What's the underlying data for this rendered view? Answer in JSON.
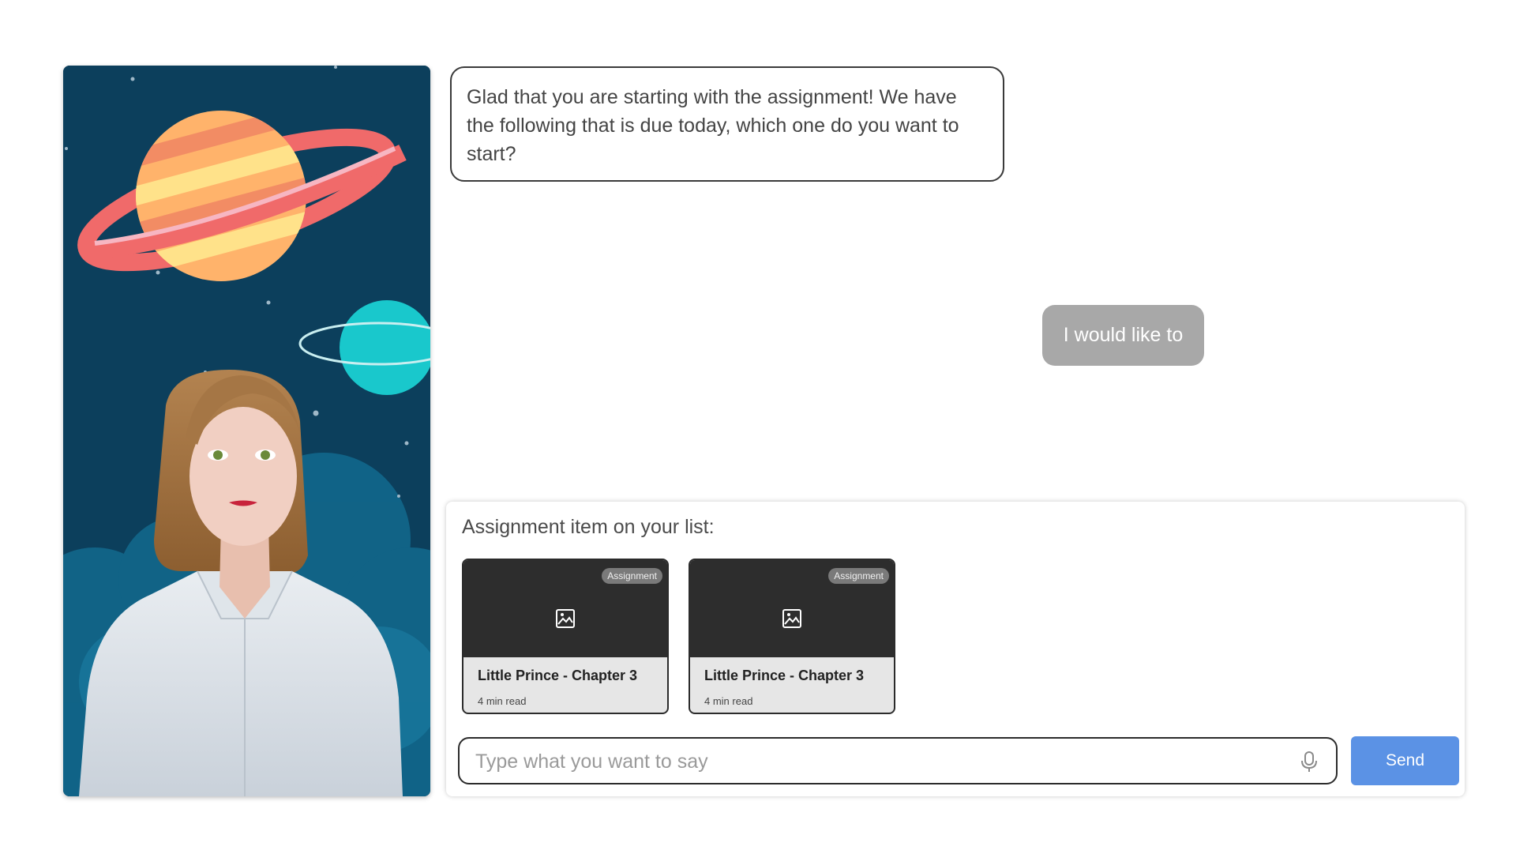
{
  "conversation": {
    "bot_message": "Glad that you are starting with the assignment! We have the following that is due today, which one do you want to start?",
    "user_message": "I would like to"
  },
  "assignments": {
    "title": "Assignment item on your list:",
    "items": [
      {
        "badge": "Assignment",
        "title": "Little Prince - Chapter 3",
        "meta": "4 min read",
        "icon": "image-icon"
      },
      {
        "badge": "Assignment",
        "title": "Little Prince - Chapter 3",
        "meta": "4 min read",
        "icon": "image-icon"
      }
    ]
  },
  "composer": {
    "placeholder": "Type what you want to say",
    "value": "",
    "mic_icon": "microphone-icon",
    "send_label": "Send"
  },
  "colors": {
    "send_button": "#5b92e5",
    "user_bubble": "#a8a8a8",
    "card_header": "#2d2d2d",
    "avatar_background": "#0d4a68"
  }
}
